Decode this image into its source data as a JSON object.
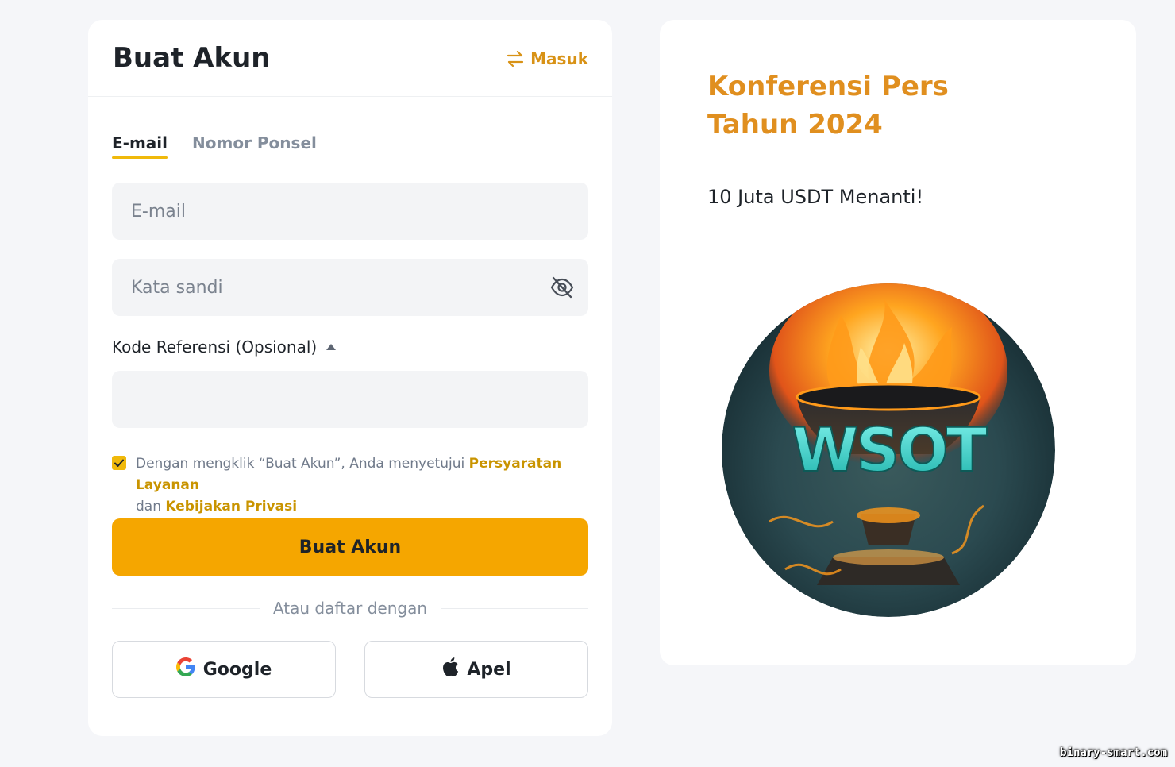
{
  "signup": {
    "title": "Buat Akun",
    "switch_link": "Masuk",
    "tabs": [
      {
        "label": "E-mail",
        "active": true
      },
      {
        "label": "Nomor Ponsel",
        "active": false
      }
    ],
    "email_placeholder": "E-mail",
    "password_placeholder": "Kata sandi",
    "referral_label": "Kode Referensi (Opsional)",
    "referral_value": "",
    "terms": {
      "checked": true,
      "prefix": "Dengan mengklik “Buat Akun”, Anda menyetujui ",
      "terms_link": "Persyaratan Layanan",
      "conjunction": " dan ",
      "privacy_link": "Kebijakan Privasi"
    },
    "submit_label": "Buat Akun",
    "divider_text": "Atau daftar dengan",
    "google_label": "Google",
    "apple_label": "Apel"
  },
  "promo": {
    "title": "Konferensi Pers Tahun 2024",
    "subtitle": "10 Juta USDT Menanti!",
    "image_text": "WSOT"
  },
  "watermark": "binary-smart.com",
  "colors": {
    "accent": "#f5a600",
    "link": "#c99400",
    "promo_title": "#e08f1f",
    "background": "#f5f6f9"
  },
  "icons": {
    "switch": "swap-arrows-icon",
    "password_toggle": "eye-slash-icon",
    "referral_toggle": "caret-up-icon",
    "google": "google-logo-icon",
    "apple": "apple-logo-icon"
  }
}
